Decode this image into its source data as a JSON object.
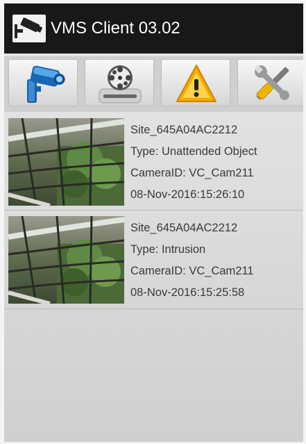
{
  "app": {
    "title": "VMS Client 03.02",
    "icon": "camera-icon"
  },
  "toolbar": {
    "buttons": [
      {
        "name": "live-camera",
        "icon": "security-camera-icon"
      },
      {
        "name": "playback",
        "icon": "film-reel-icon"
      },
      {
        "name": "alarms",
        "icon": "warning-triangle-icon"
      },
      {
        "name": "settings",
        "icon": "tools-icon"
      }
    ]
  },
  "events": [
    {
      "site": "Site_645A04AC2212",
      "type": "Type: Unattended Object",
      "camera": "CameraID: VC_Cam211",
      "timestamp": "08-Nov-2016:15:26:10"
    },
    {
      "site": "Site_645A04AC2212",
      "type": "Type: Intrusion",
      "camera": "CameraID: VC_Cam211",
      "timestamp": "08-Nov-2016:15:25:58"
    }
  ],
  "colors": {
    "title_bar": "#181818",
    "background": "#d8d8d8",
    "warning": "#f5a800"
  }
}
